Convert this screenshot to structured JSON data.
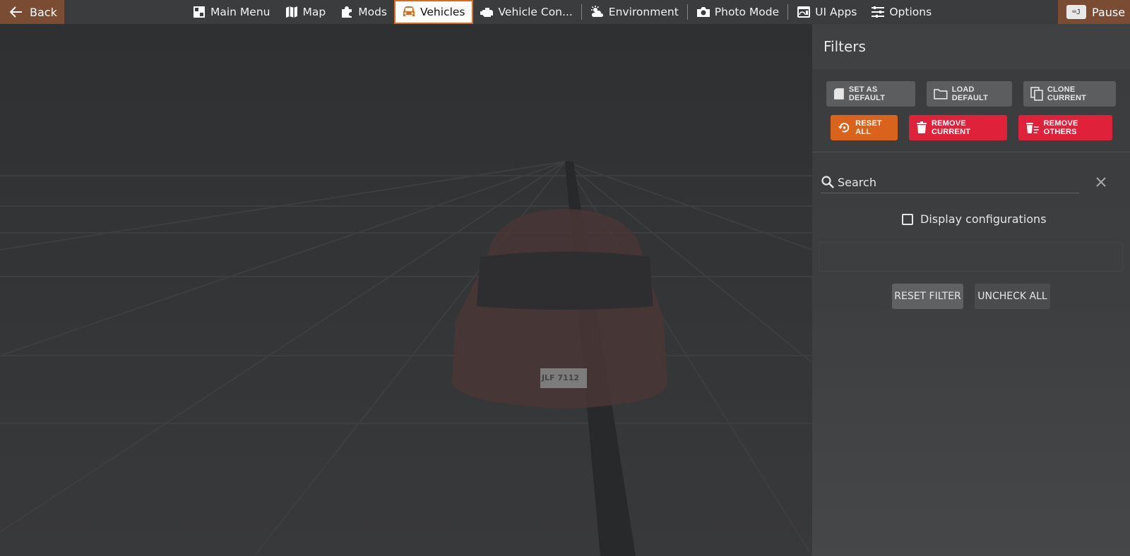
{
  "topbar": {
    "back_label": "Back",
    "pause_label": "Pause",
    "pause_key": "⌨J",
    "menu": [
      {
        "label": "Main Menu",
        "icon": "main-menu-icon"
      },
      {
        "label": "Map",
        "icon": "map-icon"
      },
      {
        "label": "Mods",
        "icon": "puzzle-icon"
      },
      {
        "label": "Vehicles",
        "icon": "car-icon",
        "active": true
      },
      {
        "label": "Vehicle Con...",
        "icon": "engine-icon"
      },
      {
        "label": "Environment",
        "icon": "weather-icon"
      },
      {
        "label": "Photo Mode",
        "icon": "camera-icon"
      },
      {
        "label": "UI Apps",
        "icon": "ui-apps-icon"
      },
      {
        "label": "Options",
        "icon": "sliders-icon"
      }
    ]
  },
  "scene": {
    "license_plate": "JLF 7112"
  },
  "filters": {
    "title": "Filters",
    "set_as_default": "SET AS DEFAULT",
    "load_default": "LOAD DEFAULT",
    "clone_current": "CLONE CURRENT",
    "reset_all": "RESET ALL",
    "remove_current": "REMOVE CURRENT",
    "remove_others": "REMOVE OTHERS",
    "search_placeholder": "Search",
    "display_configurations": "Display configurations",
    "display_configurations_checked": false,
    "reset_filter": "RESET FILTER",
    "uncheck_all": "UNCHECK ALL"
  },
  "colors": {
    "accent_orange": "#d9631c",
    "danger_red": "#e0213a",
    "back_brown": "#7a4c33"
  }
}
